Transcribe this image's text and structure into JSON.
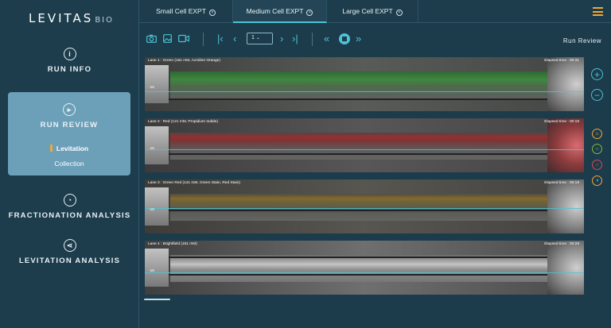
{
  "brand": {
    "name": "LEVITAS",
    "suffix": "BIO"
  },
  "sidebar": {
    "items": [
      {
        "label": "RUN INFO",
        "icon": "info-icon"
      },
      {
        "label": "RUN REVIEW",
        "icon": "play-icon",
        "active": true,
        "subitems": [
          {
            "label": "Levitation",
            "active": true
          },
          {
            "label": "Collection",
            "active": false
          }
        ]
      },
      {
        "label": "FRACTIONATION ANALYSIS",
        "icon": "pie-chart-icon"
      },
      {
        "label": "LEVITATION ANALYSIS",
        "icon": "share-icon"
      }
    ]
  },
  "tabs": [
    {
      "label": "Small Cell EXPT",
      "active": false
    },
    {
      "label": "Medium Cell EXPT",
      "active": true
    },
    {
      "label": "Large Cell EXPT",
      "active": false
    }
  ],
  "toolbar": {
    "page": "1",
    "title": "Run Review"
  },
  "lanes": [
    {
      "title": "Lane 1 : Green (161 mM, Acridine Orange)",
      "elapsed": "Elapsed time : 00:31",
      "scale": "-15"
    },
    {
      "title": "Lane 2 : Red (121 mM, Propidium Iodide)",
      "elapsed": "Elapsed time : 00:18",
      "scale": "-15"
    },
    {
      "title": "Lane 3 : Green Red (141 mM, Green Stain, Red Stain)",
      "elapsed": "Elapsed time : 00:19",
      "scale": "-15"
    },
    {
      "title": "Lane 4 : Brightfield (161 mM)",
      "elapsed": "Elapsed time : 00:29",
      "scale": "-15"
    }
  ],
  "colors": {
    "accent": "#4cc3d6",
    "highlight": "#f0a83a",
    "active_panel": "#6c9fb8",
    "background": "#1c3b4b"
  }
}
